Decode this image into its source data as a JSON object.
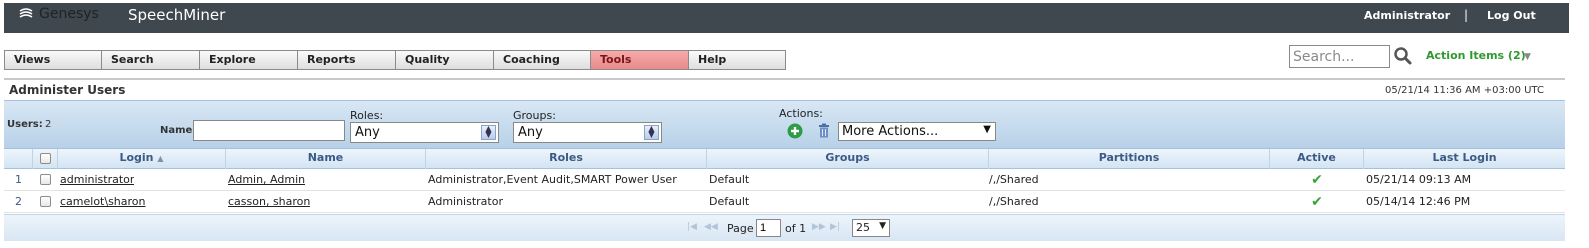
{
  "header": {
    "brand": "Genesys",
    "app_name": "SpeechMiner",
    "user": "Administrator",
    "separator": "|",
    "logout": "Log Out"
  },
  "nav": {
    "tabs": [
      {
        "label": "Views",
        "active": false
      },
      {
        "label": "Search",
        "active": false
      },
      {
        "label": "Explore",
        "active": false
      },
      {
        "label": "Reports",
        "active": false
      },
      {
        "label": "Quality",
        "active": false
      },
      {
        "label": "Coaching",
        "active": false
      },
      {
        "label": "Tools",
        "active": true
      },
      {
        "label": "Help",
        "active": false
      }
    ],
    "search_placeholder": "Search...",
    "action_items": "Action Items (2)"
  },
  "page": {
    "title": "Administer Users",
    "timestamp": "05/21/14 11:36 AM +03:00 UTC"
  },
  "filters": {
    "users_label": "Users:",
    "users_count": "2",
    "name_label": "Name:",
    "name_value": "",
    "roles_label": "Roles:",
    "roles_value": "Any",
    "groups_label": "Groups:",
    "groups_value": "Any",
    "actions_label": "Actions:",
    "more_actions": "More Actions..."
  },
  "grid": {
    "columns": [
      "Login",
      "Name",
      "Roles",
      "Groups",
      "Partitions",
      "Active",
      "Last Login"
    ],
    "sort_indicator": "▲",
    "rows": [
      {
        "num": "1",
        "login": "administrator",
        "name": "Admin, Admin",
        "roles": "Administrator,Event Audit,SMART Power User",
        "groups": "Default",
        "partitions": "/,/Shared",
        "active": "✔",
        "last_login": "05/21/14 09:13 AM"
      },
      {
        "num": "2",
        "login": "camelot\\sharon",
        "name": "casson, sharon",
        "roles": "Administrator",
        "groups": "Default",
        "partitions": "/,/Shared",
        "active": "✔",
        "last_login": "05/14/14 12:46 PM"
      }
    ]
  },
  "pager": {
    "page_label": "Page",
    "page_value": "1",
    "of_label": "of 1",
    "page_size": "25"
  },
  "colors": {
    "header_bg": "#3f474f",
    "active_tab": "#e88b8b",
    "action_items": "#2f9a2f",
    "filter_bar": "#b7d1e8",
    "grid_header_text": "#3a5a87"
  }
}
